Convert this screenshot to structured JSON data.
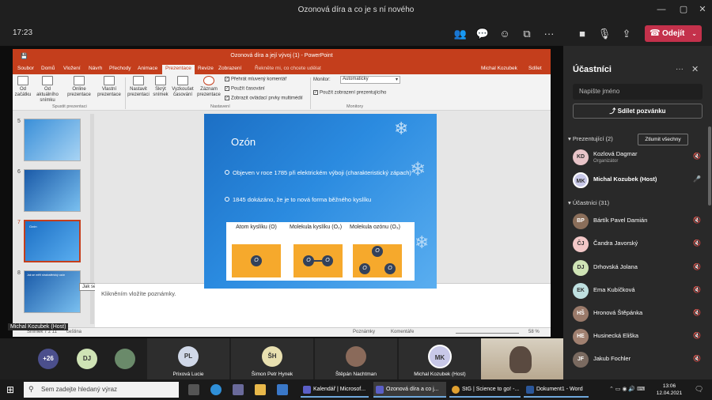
{
  "window": {
    "title": "Ozonová díra a co je s ní nového"
  },
  "meeting": {
    "timer": "17:23",
    "leave_label": "Odejít"
  },
  "ppt": {
    "window_title": "Ozonová díra a její vývoj (1) - PowerPoint",
    "search_hint": "Řekněte mi, co chcete udělat",
    "user": "Michal Kozubek",
    "share": "Sdílet",
    "tabs": [
      "Soubor",
      "Domů",
      "Vložení",
      "Návrh",
      "Přechody",
      "Animace",
      "Prezentace",
      "Revize",
      "Zobrazení"
    ],
    "active_tab": "Prezentace",
    "ribbon": {
      "btn_from_start": "Od začátku",
      "btn_from_current": "Od aktuálního snímku",
      "btn_online": "Online prezentace",
      "btn_custom": "Vlastní prezentace",
      "group_start": "Spustit prezentaci",
      "btn_setup": "Nastavit prezentaci",
      "btn_hide": "Skrýt snímek",
      "btn_rehearse": "Vyzkoušet časování",
      "btn_record": "Záznam prezentace",
      "chk_narration": "Přehrát mluvený komentář",
      "chk_timings": "Použít časování",
      "chk_controls": "Zobrazit ovládací prvky multimédií",
      "group_setup": "Nastavení",
      "monitor_label": "Monitor:",
      "monitor_value": "Automaticky",
      "chk_presenter_view": "Použít zobrazení prezentujícího",
      "group_monitors": "Monitory"
    },
    "thumbnails": [
      {
        "num": "5"
      },
      {
        "num": "6"
      },
      {
        "num": "7",
        "title": "Ozón"
      },
      {
        "num": "8",
        "title": "Jak se měří stratosférický ozón"
      }
    ],
    "tooltip": "Jak se měří stratosférický ozón",
    "slide": {
      "title": "Ozón",
      "bullet1": "Objeven v roce 1785 při elektrickém výboji (charakteristický zápach)",
      "bullet2": "1845 dokázáno, že je to nová forma běžného kyslíku",
      "mol1_label": "Atom kyslíku (O)",
      "mol2_label": "Molekula kyslíku (O₂)",
      "mol3_label": "Molekula ozónu (O₃)",
      "atom": "O"
    },
    "notes_placeholder": "Klikněním vložíte poznámky.",
    "status": {
      "slide_info": "Snímek 7 z 11",
      "lang": "čeština",
      "notes": "Poznámky",
      "comments": "Komentáře",
      "zoom": "58 %"
    },
    "presenter_tag": "Michal Kozubek (Host)"
  },
  "panel": {
    "title": "Účastníci",
    "search_placeholder": "Napište jméno",
    "share_invite": "Sdílet pozvánku",
    "presenters_header": "Prezentující (2)",
    "mute_all": "Ztlumit všechny",
    "attendees_header": "Účastníci (31)",
    "presenters": [
      {
        "initials": "KD",
        "name": "Kozlová Dagmar",
        "sub": "Organizátor",
        "color": "#e8c4c8"
      },
      {
        "initials": "MK",
        "name": "Michal Kozubek (Host)",
        "sub": "",
        "color": "#c8c8e8"
      }
    ],
    "attendees": [
      {
        "initials": "BP",
        "name": "Bártík Pavel Damián",
        "color": "#8a6e5a"
      },
      {
        "initials": "ČJ",
        "name": "Čandra Javorský",
        "color": "#f2c7c7"
      },
      {
        "initials": "DJ",
        "name": "Drhovská Jolana",
        "color": "#cfe3b5"
      },
      {
        "initials": "EK",
        "name": "Ema Kubíčková",
        "color": "#bfe0e0"
      },
      {
        "initials": "HŠ",
        "name": "Hronová Štěpánka",
        "color": "#9a7a6a"
      },
      {
        "initials": "HE",
        "name": "Husinecká Eliška",
        "color": "#a08070"
      },
      {
        "initials": "JF",
        "name": "Jakub Fochler",
        "color": "#7a6a60"
      }
    ]
  },
  "videostrip": {
    "overflow": "+26",
    "tiles": [
      {
        "initials": "DJ",
        "name": "",
        "color": "#cfe3b5"
      },
      {
        "initials": "",
        "name": "",
        "color": "#6a8a6a"
      },
      {
        "initials": "PL",
        "name": "Prixová Lucie",
        "color": "#d0d8e8"
      },
      {
        "initials": "ŠH",
        "name": "Šimon Petr Hynek",
        "color": "#e8e0b0"
      },
      {
        "initials": "",
        "name": "Štěpán Nachtman",
        "color": "#8a6a5a"
      },
      {
        "initials": "MK",
        "name": "Michal Kozubek (Host)",
        "color": "#c8c8e8"
      }
    ]
  },
  "taskbar": {
    "search_placeholder": "Sem zadejte hledaný výraz",
    "apps": [
      {
        "label": "Kalendář | Microsof...",
        "color": "#5b5fc7"
      },
      {
        "label": "Ozonová díra a co j...",
        "color": "#5b5fc7"
      },
      {
        "label": "StG | Science to go! -...",
        "color": "#e0a030"
      },
      {
        "label": "Dokument1 - Word",
        "color": "#2b579a"
      }
    ],
    "time": "13:06",
    "date": "12.04.2021"
  }
}
